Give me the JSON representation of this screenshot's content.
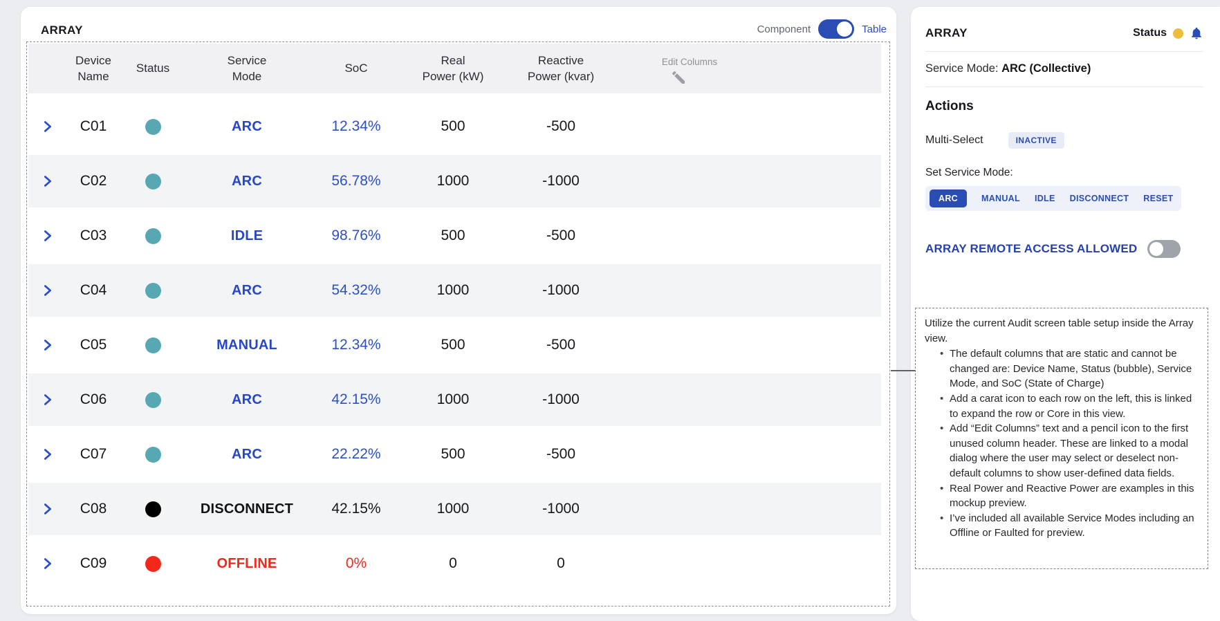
{
  "colors": {
    "accent_blue": "#2A4DB5",
    "link_blue": "#2B4EC8",
    "teal_status": "#57A8B2",
    "black_status": "#000000",
    "red_status": "#F4271B",
    "warn_yellow": "#EDBE3B",
    "row_stripe": "#F3F4F6"
  },
  "main_panel": {
    "title": "ARRAY",
    "view_toggle": {
      "left": "Component",
      "right": "Table",
      "selected": "Table"
    },
    "table": {
      "headers": {
        "device": "Device\nName",
        "status": "Status",
        "service": "Service\nMode",
        "soc": "SoC",
        "real": "Real\nPower (kW)",
        "reactive": "Reactive\nPower (kvar)"
      },
      "edit_columns": "Edit Columns",
      "rows": [
        {
          "device": "C01",
          "bubble": "#57A8B2",
          "mode": "ARC",
          "mode_color": "#2746C8",
          "soc": "12.34%",
          "soc_color": "#2B50C8",
          "real": "500",
          "reactive": "-500"
        },
        {
          "device": "C02",
          "bubble": "#57A8B2",
          "mode": "ARC",
          "mode_color": "#2746C8",
          "soc": "56.78%",
          "soc_color": "#2B50C8",
          "real": "1000",
          "reactive": "-1000"
        },
        {
          "device": "C03",
          "bubble": "#57A8B2",
          "mode": "IDLE",
          "mode_color": "#2746C8",
          "soc": "98.76%",
          "soc_color": "#2B50C8",
          "real": "500",
          "reactive": "-500"
        },
        {
          "device": "C04",
          "bubble": "#57A8B2",
          "mode": "ARC",
          "mode_color": "#2746C8",
          "soc": "54.32%",
          "soc_color": "#2B50C8",
          "real": "1000",
          "reactive": "-1000"
        },
        {
          "device": "C05",
          "bubble": "#57A8B2",
          "mode": "MANUAL",
          "mode_color": "#2746C8",
          "soc": "12.34%",
          "soc_color": "#2B50C8",
          "real": "500",
          "reactive": "-500"
        },
        {
          "device": "C06",
          "bubble": "#57A8B2",
          "mode": "ARC",
          "mode_color": "#2746C8",
          "soc": "42.15%",
          "soc_color": "#2B50C8",
          "real": "1000",
          "reactive": "-1000"
        },
        {
          "device": "C07",
          "bubble": "#57A8B2",
          "mode": "ARC",
          "mode_color": "#2746C8",
          "soc": "22.22%",
          "soc_color": "#2B50C8",
          "real": "500",
          "reactive": "-500"
        },
        {
          "device": "C08",
          "bubble": "#000000",
          "mode": "DISCONNECT",
          "mode_color": "#121217",
          "soc": "42.15%",
          "soc_color": "#17171C",
          "real": "1000",
          "reactive": "-1000"
        },
        {
          "device": "C09",
          "bubble": "#F4271B",
          "mode": "OFFLINE",
          "mode_color": "#F4271B",
          "soc": "0%",
          "soc_color": "#F4271B",
          "real": "0",
          "reactive": "0"
        }
      ]
    }
  },
  "sidebar": {
    "title": "ARRAY",
    "status_label": "Status",
    "service_mode_label": "Service Mode:",
    "service_mode_value": "ARC (Collective)",
    "actions_title": "Actions",
    "multi_select_label": "Multi-Select",
    "multi_select_state": "INACTIVE",
    "set_service_mode_label": "Set Service Mode:",
    "mode_buttons": [
      {
        "label": "ARC",
        "selected": true
      },
      {
        "label": "MANUAL"
      },
      {
        "label": "IDLE"
      },
      {
        "label": "DISCONNECT"
      },
      {
        "label": "RESET"
      }
    ],
    "remote_access": {
      "label": "ARRAY REMOTE ACCESS ALLOWED",
      "enabled": false
    }
  },
  "note": {
    "intro": "Utilize the current Audit screen table setup inside the Array view.",
    "bullets": [
      "The default columns that are static and cannot be changed are: Device Name, Status (bubble), Service Mode, and SoC (State of Charge)",
      "Add a carat icon to each row on the left, this is linked to expand the row or Core in this view.",
      "Add “Edit Columns” text and a pencil icon to the first unused column header. These are linked to a modal dialog where the user may select or deselect non-default columns to show user-defined data fields.",
      "Real Power and Reactive Power are examples in this mockup preview.",
      "I’ve included all available Service Modes including an Offline or Faulted for preview."
    ]
  }
}
